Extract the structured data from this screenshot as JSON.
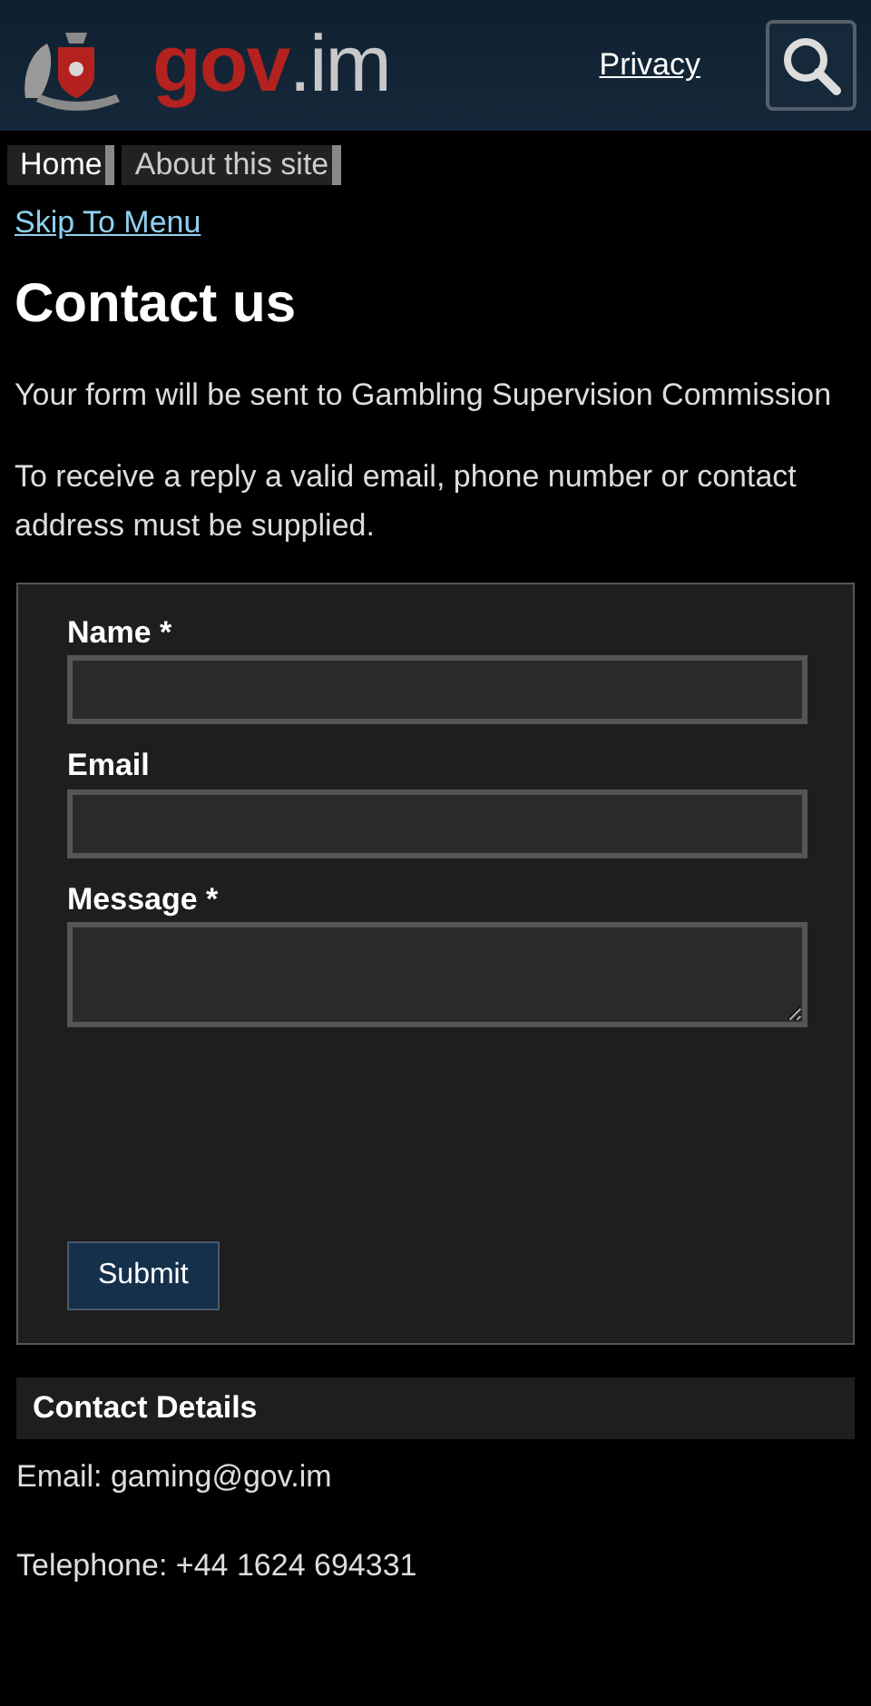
{
  "header": {
    "logo": {
      "first": "gov",
      "second": ".im"
    },
    "privacy_link": "Privacy"
  },
  "breadcrumbs": [
    {
      "label": "Home"
    },
    {
      "label": "About this site"
    }
  ],
  "skip_link": "Skip To Menu",
  "title": "Contact us",
  "intro": [
    "Your form will be sent to Gambling Supervision Commission",
    "To receive a reply a valid email, phone number or contact address must be supplied."
  ],
  "form": {
    "fields": [
      {
        "label": "Name",
        "required_mark": "*",
        "kind": "input"
      },
      {
        "label": "Email",
        "kind": "input"
      },
      {
        "label": "Message",
        "required_mark": "*",
        "kind": "textarea"
      }
    ],
    "submit": "Submit"
  },
  "contact_details": {
    "heading": "Contact Details",
    "lines": [
      "Email: gaming@gov.im",
      "Telephone: +44 1624 694331"
    ]
  }
}
